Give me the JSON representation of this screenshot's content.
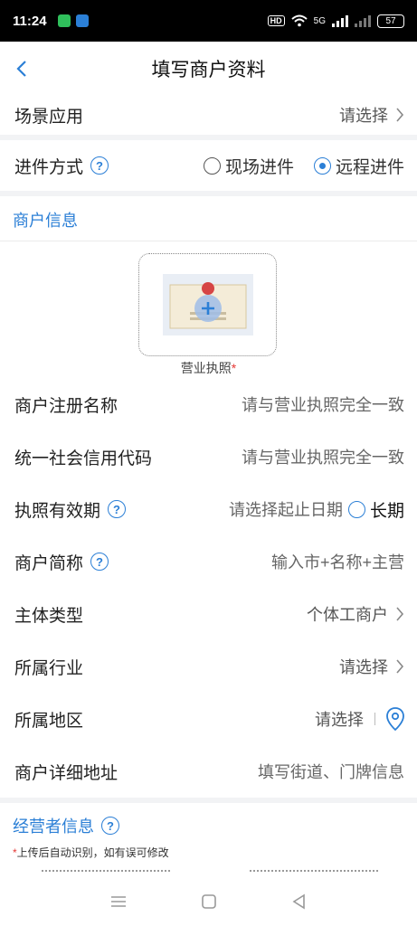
{
  "status_bar": {
    "time": "11:24",
    "network": "5G",
    "battery": "57"
  },
  "nav": {
    "title": "填写商户资料"
  },
  "rows": {
    "scene": {
      "label": "场景应用",
      "value": "请选择"
    },
    "entry_method": {
      "label": "进件方式",
      "options": [
        "现场进件",
        "远程进件"
      ],
      "selected": "远程进件"
    },
    "merchant_name": {
      "label": "商户注册名称",
      "placeholder": "请与营业执照完全一致"
    },
    "credit_code": {
      "label": "统一社会信用代码",
      "placeholder": "请与营业执照完全一致"
    },
    "validity": {
      "label": "执照有效期",
      "placeholder": "请选择起止日期",
      "long_term": "长期"
    },
    "short_name": {
      "label": "商户简称",
      "placeholder": "输入市+名称+主营"
    },
    "entity_type": {
      "label": "主体类型",
      "value": "个体工商户"
    },
    "industry": {
      "label": "所属行业",
      "value": "请选择"
    },
    "region": {
      "label": "所属地区",
      "value": "请选择"
    },
    "address": {
      "label": "商户详细地址",
      "placeholder": "填写街道、门牌信息"
    }
  },
  "sections": {
    "merchant_info": "商户信息",
    "operator_info": "经营者信息"
  },
  "upload": {
    "label": "营业执照",
    "required_mark": "*"
  },
  "note": {
    "mark": "*",
    "text": "上传后自动识别，如有误可修改"
  },
  "colors": {
    "accent": "#2b7fd6",
    "required": "#e53935",
    "section_bg": "#f2f3f5"
  }
}
